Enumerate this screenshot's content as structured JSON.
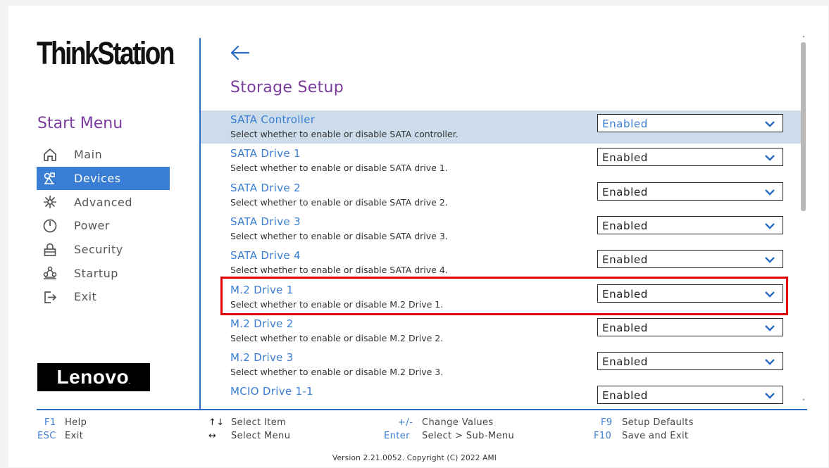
{
  "brand": {
    "name": "ThinkStation",
    "trademark": "."
  },
  "sidebar": {
    "title": "Start Menu",
    "items": [
      {
        "label": "Main",
        "icon": "home-icon",
        "active": false
      },
      {
        "label": "Devices",
        "icon": "devices-icon",
        "active": true
      },
      {
        "label": "Advanced",
        "icon": "advanced-icon",
        "active": false
      },
      {
        "label": "Power",
        "icon": "power-icon",
        "active": false
      },
      {
        "label": "Security",
        "icon": "lock-icon",
        "active": false
      },
      {
        "label": "Startup",
        "icon": "startup-icon",
        "active": false
      },
      {
        "label": "Exit",
        "icon": "exit-icon",
        "active": false
      }
    ]
  },
  "logo": {
    "text": "Lenovo",
    "trademark": "."
  },
  "page": {
    "title": "Storage Setup",
    "back_icon": "back-arrow-icon"
  },
  "settings": [
    {
      "label": "SATA Controller",
      "description": "Select whether to enable or disable SATA controller.",
      "value": "Enabled"
    },
    {
      "label": "SATA Drive 1",
      "description": "Select whether to enable or disable SATA drive 1.",
      "value": "Enabled"
    },
    {
      "label": "SATA Drive 2",
      "description": "Select whether to enable or disable SATA drive 2.",
      "value": "Enabled"
    },
    {
      "label": "SATA Drive 3",
      "description": "Select whether to enable or disable SATA drive 3.",
      "value": "Enabled"
    },
    {
      "label": "SATA Drive 4",
      "description": "Select whether to enable or disable SATA drive 4.",
      "value": "Enabled"
    },
    {
      "label": "M.2 Drive 1",
      "description": "Select whether to enable or disable M.2 Drive 1.",
      "value": "Enabled"
    },
    {
      "label": "M.2 Drive 2",
      "description": "Select whether to enable or disable M.2 Drive 2.",
      "value": "Enabled"
    },
    {
      "label": "M.2 Drive 3",
      "description": "Select whether to enable or disable M.2 Drive 3.",
      "value": "Enabled"
    },
    {
      "label": "MCIO Drive 1-1",
      "description": "",
      "value": "Enabled"
    }
  ],
  "footer": {
    "hints": [
      {
        "key": "F1",
        "desc": "Help"
      },
      {
        "key": "ESC",
        "desc": "Exit"
      },
      {
        "key": "↑↓",
        "desc": "Select Item"
      },
      {
        "key": "↔",
        "desc": "Select Menu"
      },
      {
        "key": "+/-",
        "desc": "Change Values"
      },
      {
        "key": "Enter",
        "desc": "Select > Sub-Menu"
      },
      {
        "key": "F9",
        "desc": "Setup Defaults"
      },
      {
        "key": "F10",
        "desc": "Save and Exit"
      }
    ],
    "version": "Version 2.21.0052. Copyright (C) 2022 AMI"
  },
  "colors": {
    "accent": "#3a7dd4",
    "title_purple": "#7a3d9e",
    "selected_row": "#cddceb",
    "highlight_box": "#e10000"
  }
}
